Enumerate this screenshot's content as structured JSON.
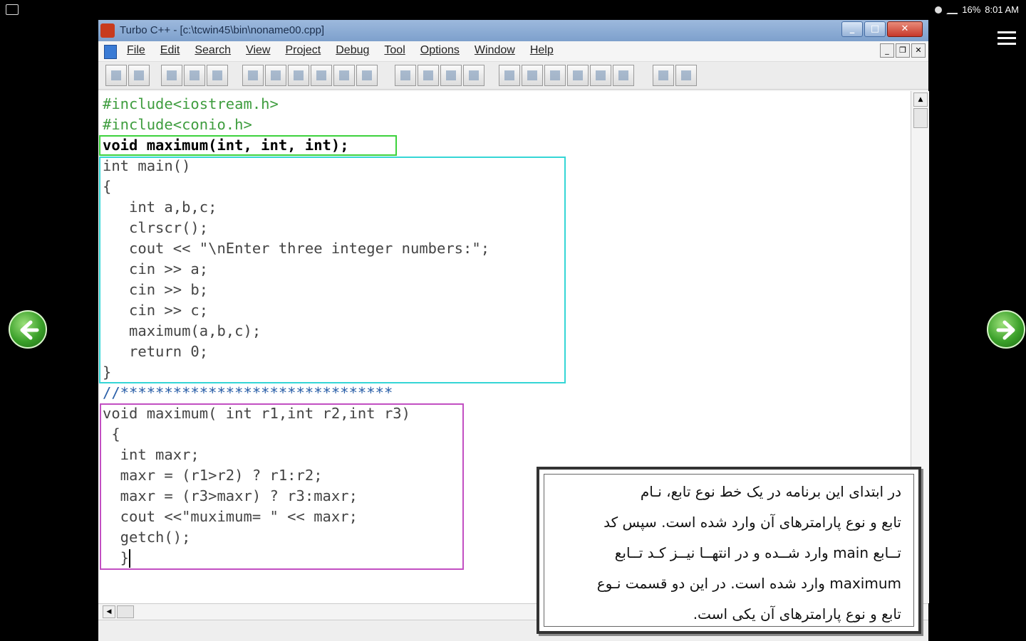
{
  "status_bar": {
    "battery_text": "16%",
    "time": "8:01 AM"
  },
  "window": {
    "title": "Turbo C++ - [c:\\tcwin45\\bin\\noname00.cpp]"
  },
  "menu": {
    "items": [
      "File",
      "Edit",
      "Search",
      "View",
      "Project",
      "Debug",
      "Tool",
      "Options",
      "Window",
      "Help"
    ]
  },
  "code": {
    "lines": [
      "#include<iostream.h>",
      "#include<conio.h>",
      "void maximum(int, int, int);",
      "int main()",
      "{",
      "   int a,b,c;",
      "   clrscr();",
      "   cout << \"\\nEnter three integer numbers:\";",
      "   cin >> a;",
      "   cin >> b;",
      "   cin >> c;",
      "   maximum(a,b,c);",
      "   return 0;",
      "}",
      "//*******************************",
      "void maximum( int r1,int r2,int r3)",
      " {",
      "  int maxr;",
      "  maxr = (r1>r2) ? r1:r2;",
      "  maxr = (r3>maxr) ? r3:maxr;",
      "  cout <<\"muximum= \" << maxr;",
      "  getch();",
      "  }"
    ]
  },
  "note": {
    "text": "در ابتدای این برنامه در یک خط نوع تابع، نـام\nتابع و نوع پارامترهای آن وارد شده است. سپس کد\nتــابع main وارد شــده و در انتهــا نیــز کـد تــابع\nmaximum وارد شده است. در این دو قسمت نـوع\nتابع و نوع پارامترهای آن یکی است."
  }
}
